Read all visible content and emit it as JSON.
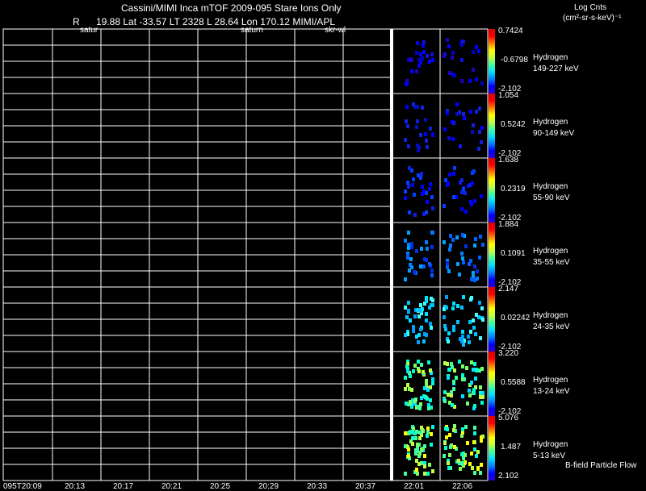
{
  "header": {
    "title": "Cassini/MIMI Inca mTOF  2009-095   Stare    Ions Only",
    "info_r": "R",
    "info_main": "19.88 Lat -33.57 LT 2328 L        28.64 Lon      170.12  MIMI/APL",
    "tag_satur": "satur",
    "tag_saturn": "saturn",
    "tag_skr": "skr-wl"
  },
  "colorbar_title": {
    "line1": "Log Cnts",
    "line2": "(cm²-sr-s-keV)⁻¹"
  },
  "x_ticks": [
    "095T20:09",
    "20:13",
    "20:17",
    "20:21",
    "20:25",
    "20:29",
    "20:33",
    "20:37",
    "22:01",
    "22:06"
  ],
  "footer_note": "B-field Particle Flow",
  "chart_data": {
    "type": "heatmap",
    "colors": {
      "background": "#000000",
      "grid": "#ffffff",
      "colormap": [
        "#2a00d4",
        "#0000ff",
        "#0080ff",
        "#00e0ff",
        "#40ffa0",
        "#c0ff40",
        "#ffff00",
        "#ff8000",
        "#ff0000",
        "#e00000"
      ]
    },
    "panels": [
      {
        "species": "Hydrogen",
        "energy": "149-227 keV",
        "cmax": "0.7424",
        "cmid": "-0.6798",
        "cmin": "-2.102"
      },
      {
        "species": "Hydrogen",
        "energy": "90-149 keV",
        "cmax": "1.054",
        "cmid": "0.5242",
        "cmin": "-2.102"
      },
      {
        "species": "Hydrogen",
        "energy": "55-90 keV",
        "cmax": "1.638",
        "cmid": "0.2319",
        "cmin": "-2.102"
      },
      {
        "species": "Hydrogen",
        "energy": "35-55 keV",
        "cmax": "1.884",
        "cmid": "0.1091",
        "cmin": "-2.102"
      },
      {
        "species": "Hydrogen",
        "energy": "24-35 keV",
        "cmax": "2.147",
        "cmid": "0.02242",
        "cmin": "-2.102"
      },
      {
        "species": "Hydrogen",
        "energy": "13-24 keV",
        "cmax": "3.220",
        "cmid": "0.5588",
        "cmin": "-2.102"
      },
      {
        "species": "Hydrogen",
        "energy": "5-13 keV",
        "cmax": "5.076",
        "cmid": "1.487",
        "cmin": "2.102"
      }
    ]
  }
}
